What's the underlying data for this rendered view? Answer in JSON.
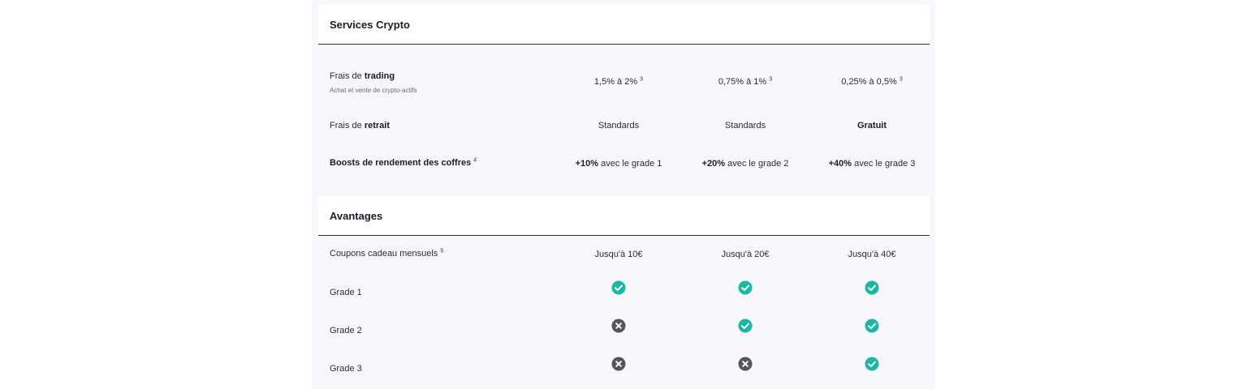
{
  "colors": {
    "panel_bg": "#f8f7fb",
    "check": "#1cb6a4",
    "cross": "#55555f",
    "text": "#1d1d2b"
  },
  "crypto": {
    "title": "Services Crypto",
    "trading": {
      "label_prefix": "Frais de",
      "label_bold": "trading",
      "sublabel": "Achat et vente de crypto-actifs",
      "values": [
        {
          "text": "1,5% à 2%",
          "note": "3"
        },
        {
          "text": "0,75% à 1%",
          "note": "3"
        },
        {
          "text": "0,25% à 0,5%",
          "note": "3"
        }
      ]
    },
    "retrait": {
      "label_prefix": "Frais de",
      "label_bold": "retrait",
      "values": [
        "Standards",
        "Standards",
        "Gratuit"
      ]
    },
    "boosts": {
      "label": "Boosts de rendement des coffres",
      "note": "4",
      "values": [
        {
          "bold": "+10%",
          "rest": "avec le grade 1"
        },
        {
          "bold": "+20%",
          "rest": "avec le grade 2"
        },
        {
          "bold": "+40%",
          "rest": "avec le grade 3"
        }
      ]
    }
  },
  "avantages": {
    "title": "Avantages",
    "coupons": {
      "label": "Coupons cadeau mensuels",
      "note": "5",
      "values": [
        "Jusqu'à 10€",
        "Jusqu'à 20€",
        "Jusqu'à 40€"
      ]
    },
    "grades": [
      {
        "label": "Grade 1",
        "icons": [
          "check-icon",
          "check-icon",
          "check-icon"
        ]
      },
      {
        "label": "Grade 2",
        "icons": [
          "cross-icon",
          "check-icon",
          "check-icon"
        ]
      },
      {
        "label": "Grade 3",
        "icons": [
          "cross-icon",
          "cross-icon",
          "check-icon"
        ]
      }
    ]
  }
}
